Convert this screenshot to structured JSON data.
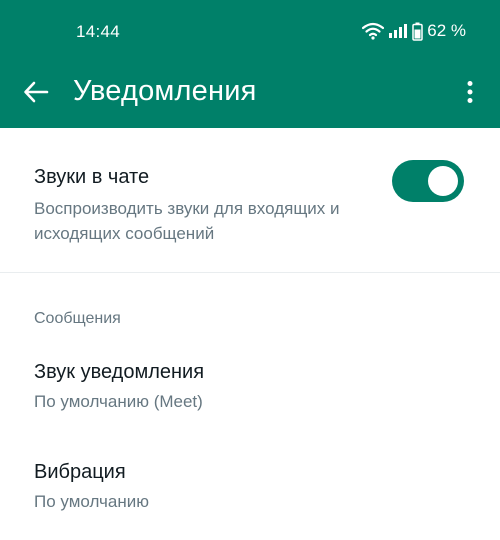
{
  "status_bar": {
    "time": "14:44",
    "battery_text": "62 %",
    "icons": [
      "wifi-icon",
      "signal-icon",
      "battery-icon"
    ]
  },
  "app_bar": {
    "title": "Уведомления",
    "back_icon": "arrow-left-icon",
    "menu_icon": "more-vert-icon"
  },
  "chat_sounds": {
    "title": "Звуки в чате",
    "subtitle": "Воспроизводить звуки для входящих и исходящих сообщений",
    "enabled": true
  },
  "messages_section": {
    "header": "Сообщения",
    "items": [
      {
        "title": "Звук уведомления",
        "value": "По умолчанию (Meet)"
      },
      {
        "title": "Вибрация",
        "value": "По умолчанию"
      }
    ]
  },
  "colors": {
    "accent": "#008069",
    "primary_text": "#111b21",
    "secondary_text": "#667781",
    "divider": "#e9edef"
  }
}
